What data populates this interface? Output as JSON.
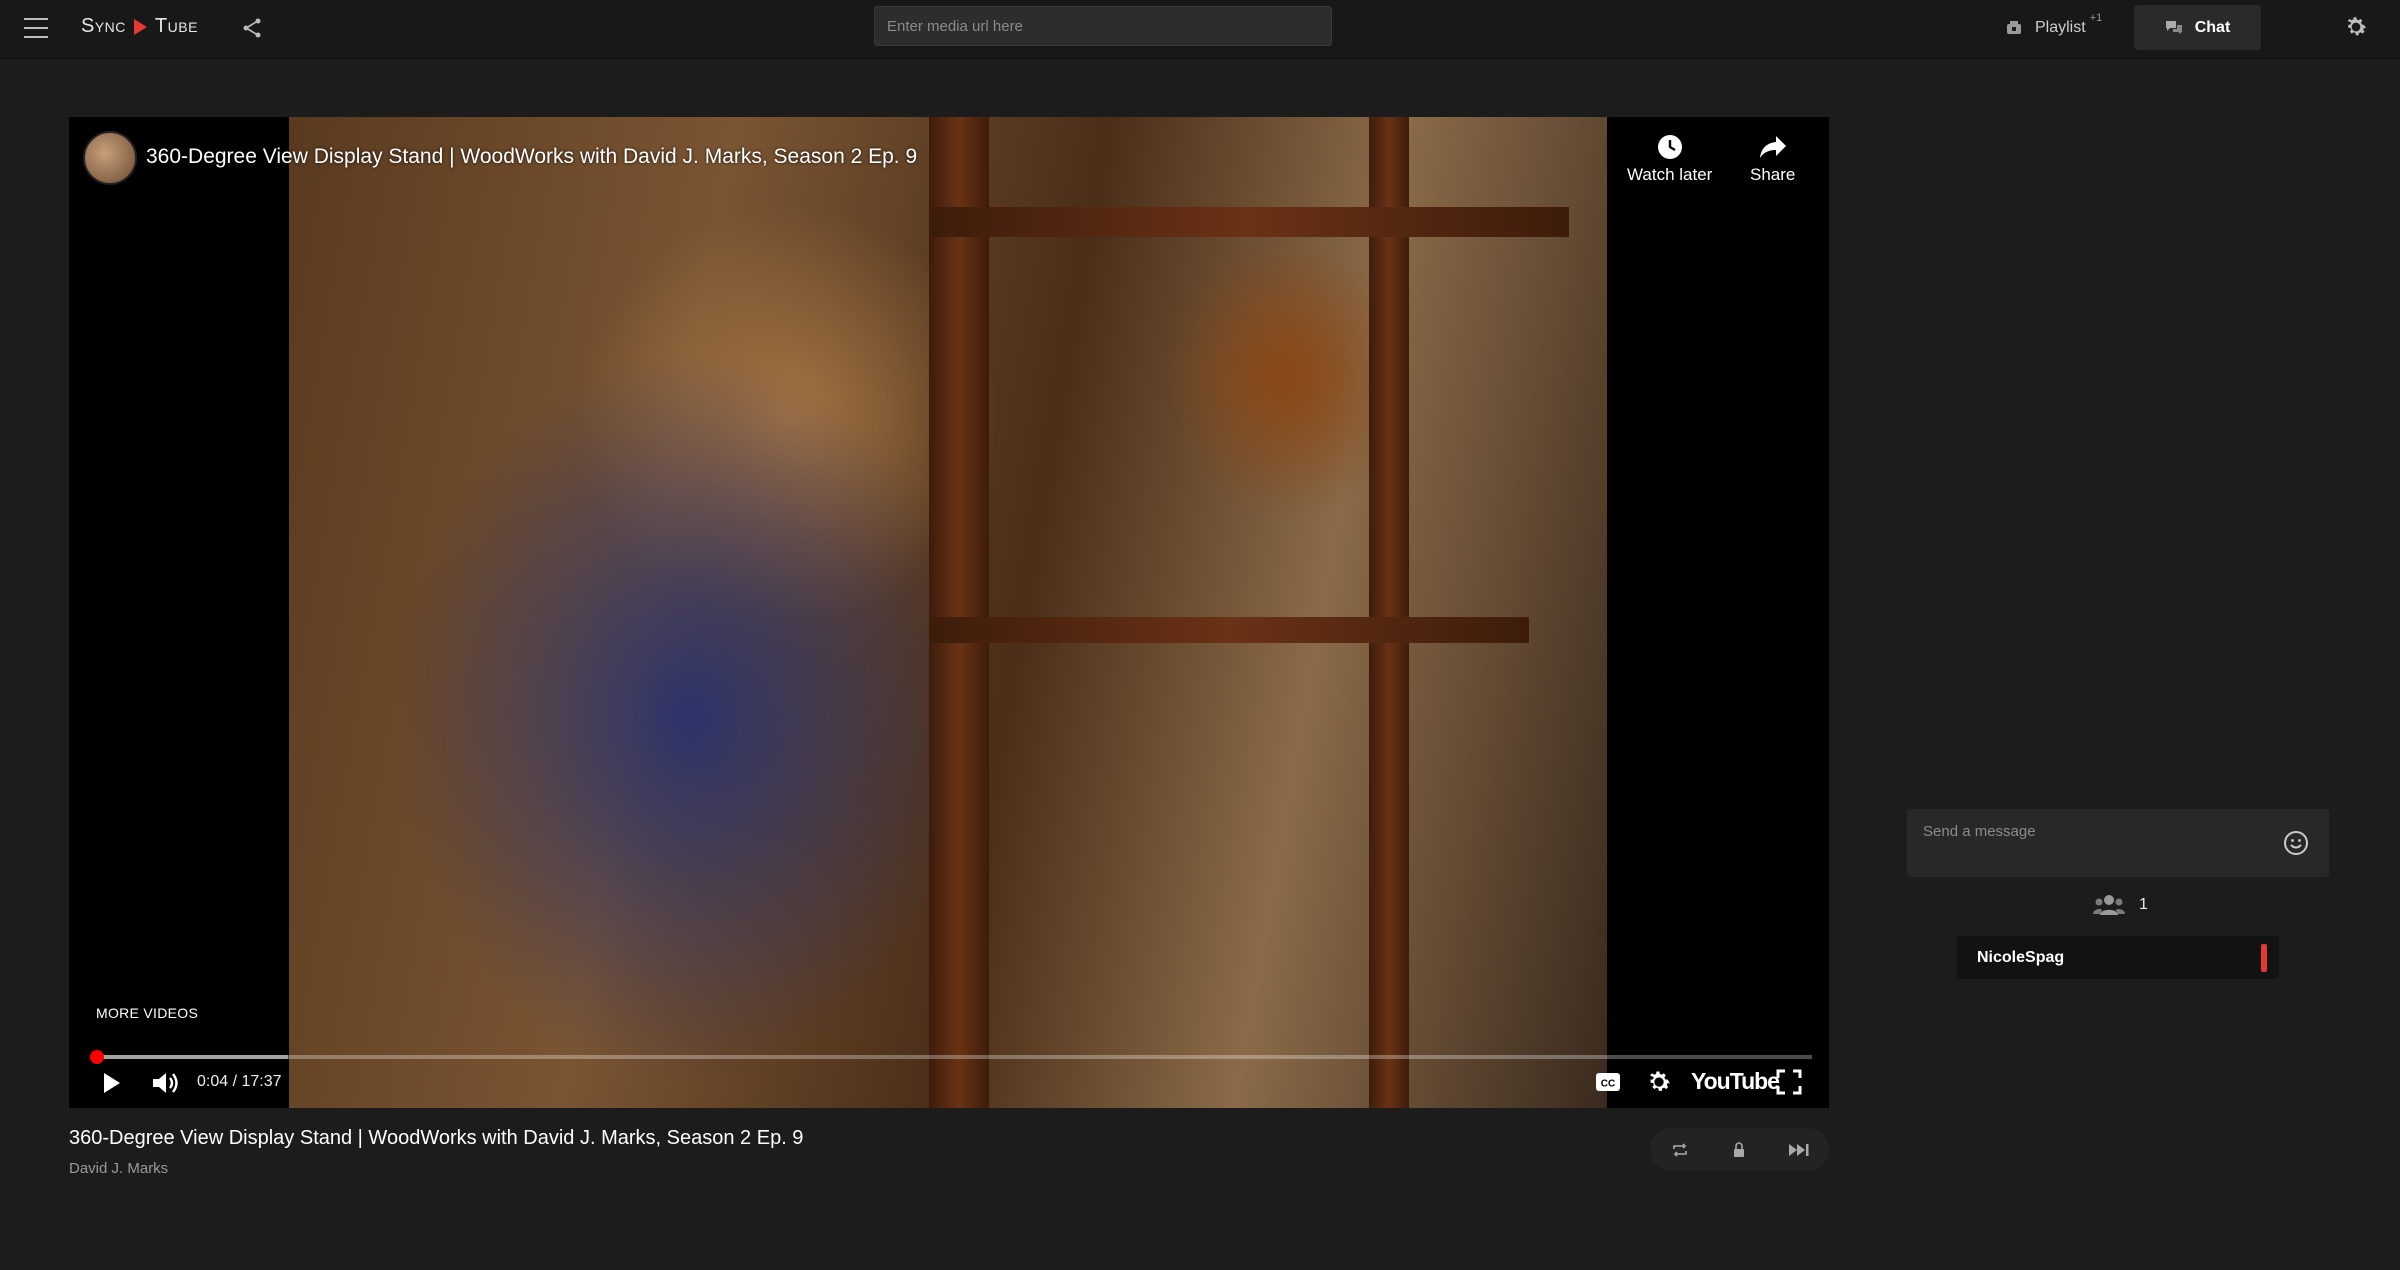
{
  "header": {
    "logo_left": "Sync",
    "logo_right": "Tube",
    "url_placeholder": "Enter media url here",
    "playlist_label": "Playlist",
    "playlist_badge": "+1",
    "chat_label": "Chat"
  },
  "player": {
    "title": "360-Degree View Display Stand | WoodWorks with David J. Marks, Season 2 Ep. 9",
    "watch_later_label": "Watch later",
    "share_label": "Share",
    "more_videos_label": "MORE VIDEOS",
    "time_display": "0:04 / 17:37",
    "youtube_label": "YouTube",
    "progress_played_fraction": 0.004,
    "progress_buffered_fraction": 0.115
  },
  "below": {
    "title": "360-Degree View Display Stand | WoodWorks with David J. Marks, Season 2 Ep. 9",
    "author": "David J. Marks"
  },
  "chat": {
    "message_placeholder": "Send a message",
    "user_count": "1",
    "users": [
      {
        "name": "NicoleSpag",
        "color": "#e53935"
      }
    ]
  },
  "colors": {
    "accent": "#e53935",
    "progress": "#ff0000",
    "background": "#1c1c1c"
  },
  "icons": [
    "menu-icon",
    "logo-play-icon",
    "share-icon",
    "playlist-icon",
    "chat-icon",
    "settings-icon",
    "clock-icon",
    "share-arrow-icon",
    "play-icon",
    "volume-icon",
    "captions-icon",
    "player-settings-icon",
    "fullscreen-icon",
    "repeat-icon",
    "lock-icon",
    "skip-next-icon",
    "emoji-icon",
    "users-icon"
  ]
}
